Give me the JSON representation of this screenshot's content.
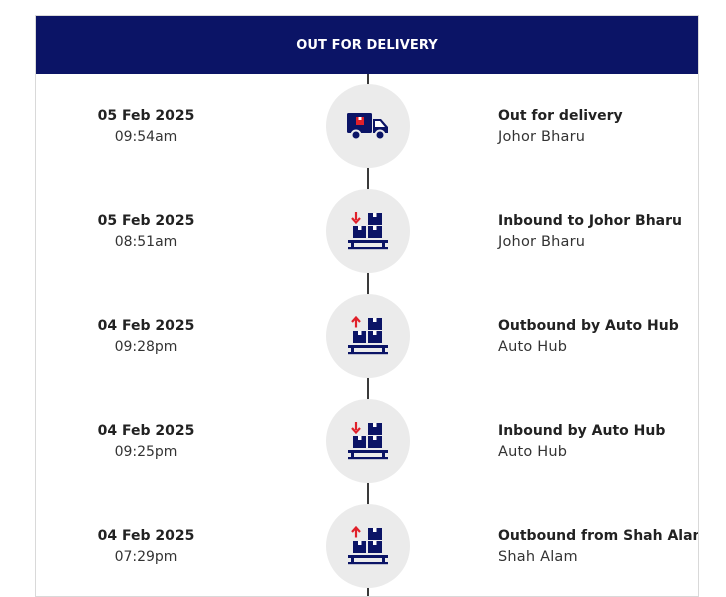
{
  "header": {
    "title": "OUT FOR DELIVERY"
  },
  "events": [
    {
      "date": "05 Feb 2025",
      "time": "09:54am",
      "status": "Out for delivery",
      "location": "Johor Bharu",
      "icon": "delivery-truck-icon"
    },
    {
      "date": "05 Feb 2025",
      "time": "08:51am",
      "status": "Inbound to Johor Bharu",
      "location": "Johor Bharu",
      "icon": "inbound-parcels-icon"
    },
    {
      "date": "04 Feb 2025",
      "time": "09:28pm",
      "status": "Outbound by Auto Hub",
      "location": "Auto Hub",
      "icon": "outbound-parcels-icon"
    },
    {
      "date": "04 Feb 2025",
      "time": "09:25pm",
      "status": "Inbound by Auto Hub",
      "location": "Auto Hub",
      "icon": "inbound-parcels-icon"
    },
    {
      "date": "04 Feb 2025",
      "time": "07:29pm",
      "status": "Outbound from Shah Alam",
      "location": "Shah Alam",
      "icon": "outbound-parcels-icon"
    }
  ],
  "colors": {
    "header_bg": "#0b1466",
    "icon_navy": "#0b1466",
    "icon_red": "#e0202a",
    "circle_bg": "#ebebeb"
  }
}
